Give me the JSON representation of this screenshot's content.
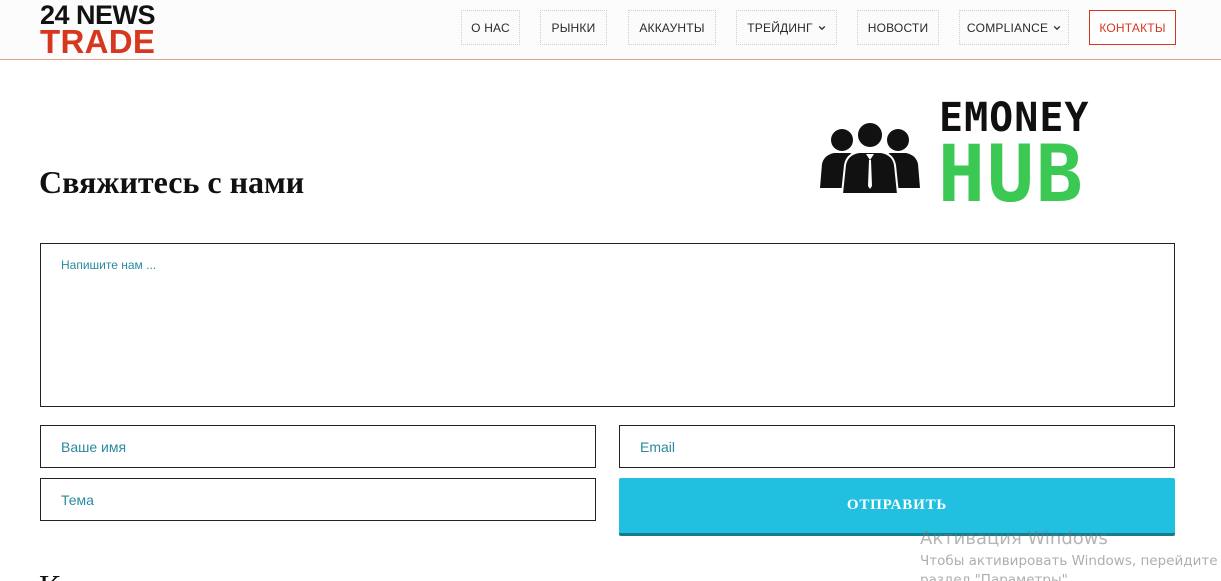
{
  "header": {
    "logo_top": "24 NEWS",
    "logo_bottom": "TRADE",
    "nav": [
      {
        "label": "О НАС",
        "has_dropdown": false
      },
      {
        "label": "РЫНКИ",
        "has_dropdown": false
      },
      {
        "label": "АККАУНТЫ",
        "has_dropdown": false
      },
      {
        "label": "ТРЕЙДИНГ",
        "has_dropdown": true
      },
      {
        "label": "НОВОСТИ",
        "has_dropdown": false
      },
      {
        "label": "COMPLIANCE",
        "has_dropdown": true
      },
      {
        "label": "КОНТАКТЫ",
        "has_dropdown": false
      }
    ],
    "accent_color": "#d8371f"
  },
  "main": {
    "title": "Свяжитесь с нами",
    "brand_logo": {
      "word_top": "EMONEY",
      "word_bottom": "HUB",
      "icon": "team-people-icon",
      "green": "#3bc954"
    },
    "form": {
      "message_placeholder": "Напишите нам ...",
      "name_placeholder": "Ваше имя",
      "email_placeholder": "Email",
      "subject_placeholder": "Тема",
      "submit_label": "ОТПРАВИТЬ",
      "submit_color": "#22c0e0"
    },
    "next_heading": "К"
  },
  "watermark": {
    "title": "Активация Windows",
    "line1": "Чтобы активировать Windows, перейдите в",
    "line2": "раздел \"Параметры\"."
  }
}
